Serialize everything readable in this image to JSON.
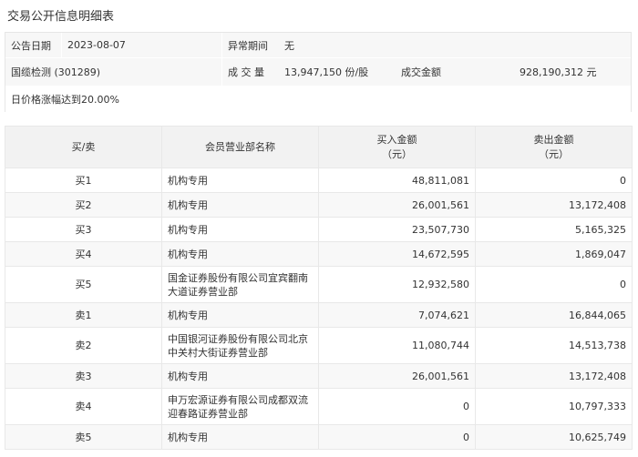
{
  "title": "交易公开信息明细表",
  "info": {
    "date_label": "公告日期",
    "date_value": "2023-08-07",
    "period_label": "异常期间",
    "period_value": "无",
    "stock": "国缆检测 (301289)",
    "volume_label": "成 交 量",
    "volume_value": "13,947,150 份/股",
    "amount_label": "成交金额",
    "amount_value": "928,190,312 元",
    "reason": "日价格涨幅达到20.00%"
  },
  "table": {
    "headers": {
      "side": "买/卖",
      "name": "会员营业部名称",
      "buy_line1": "买入金额",
      "buy_line2": "（元）",
      "sell_line1": "卖出金额",
      "sell_line2": "（元）"
    },
    "rows": [
      {
        "side": "买1",
        "name": "机构专用",
        "buy": "48,811,081",
        "sell": "0"
      },
      {
        "side": "买2",
        "name": "机构专用",
        "buy": "26,001,561",
        "sell": "13,172,408"
      },
      {
        "side": "买3",
        "name": "机构专用",
        "buy": "23,507,730",
        "sell": "5,165,325"
      },
      {
        "side": "买4",
        "name": "机构专用",
        "buy": "14,672,595",
        "sell": "1,869,047"
      },
      {
        "side": "买5",
        "name": "国金证券股份有限公司宜宾翻南大道证券营业部",
        "buy": "12,932,580",
        "sell": "0"
      },
      {
        "side": "卖1",
        "name": "机构专用",
        "buy": "7,074,621",
        "sell": "16,844,065"
      },
      {
        "side": "卖2",
        "name": "中国银河证券股份有限公司北京中关村大街证券营业部",
        "buy": "11,080,744",
        "sell": "14,513,738"
      },
      {
        "side": "卖3",
        "name": "机构专用",
        "buy": "26,001,561",
        "sell": "13,172,408"
      },
      {
        "side": "卖4",
        "name": "申万宏源证券有限公司成都双流迎春路证券营业部",
        "buy": "0",
        "sell": "10,797,333"
      },
      {
        "side": "卖5",
        "name": "机构专用",
        "buy": "0",
        "sell": "10,625,749"
      }
    ]
  }
}
